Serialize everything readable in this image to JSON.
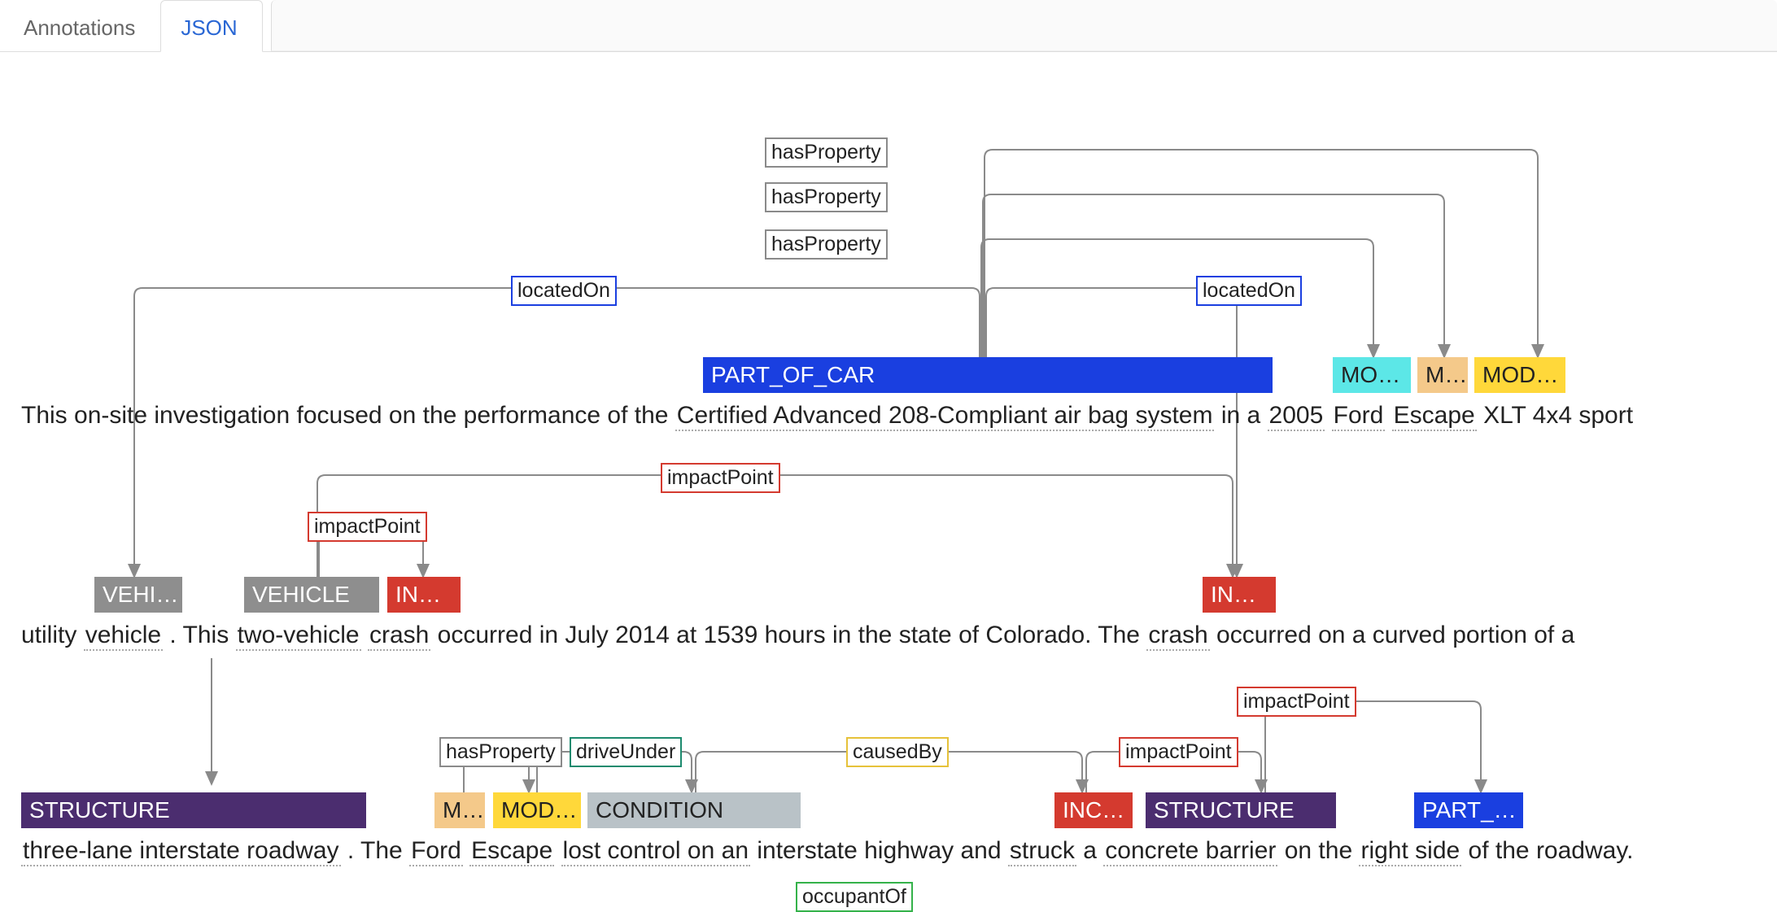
{
  "tabs": {
    "annotations": "Annotations",
    "json": "JSON"
  },
  "line1": {
    "pre": "This on-site investigation focused on the performance of the ",
    "ent_part": "Certified Advanced 208-Compliant air bag system",
    "mid1": " in a ",
    "ent_year": "2005",
    "sp1": " ",
    "ent_make": "Ford",
    "sp2": " ",
    "ent_model": "Escape",
    "tail": " XLT 4x4 sport"
  },
  "line2": {
    "pre": "utility ",
    "ent_vehicle": "vehicle",
    "mid1": " . This ",
    "ent_twoveh": "two-vehicle",
    "sp1": " ",
    "ent_crash1": "crash",
    "mid2": " occurred in July 2014 at 1539 hours in the state of Colorado. The ",
    "ent_crash2": "crash",
    "tail": " occurred on a curved portion of a"
  },
  "line3": {
    "ent_struct1": "three-lane interstate roadway",
    "mid1": " . The ",
    "ent_make2": "Ford",
    "sp1": " ",
    "ent_model2": "Escape",
    "sp2": " ",
    "ent_cond": "lost control on an",
    "mid2": " interstate highway and ",
    "ent_inc": "struck",
    "mid3": " a ",
    "ent_struct2": "concrete barrier",
    "mid4": " on the ",
    "ent_part2": "right side",
    "tail": " of the roadway."
  },
  "labels": {
    "part_of_car": "PART_OF_CAR",
    "mo_trunc": "MO…",
    "m_trunc": "M…",
    "mod_trunc": "MOD…",
    "vehi_trunc": "VEHI…",
    "vehicle": "VEHICLE",
    "in_trunc": "IN…",
    "structure": "STRUCTURE",
    "condition": "CONDITION",
    "inc_trunc": "INC…",
    "part_trunc": "PART_…"
  },
  "relations": {
    "hasProperty": "hasProperty",
    "locatedOn": "locatedOn",
    "impactPoint": "impactPoint",
    "driveUnder": "driveUnder",
    "causedBy": "causedBy",
    "occupantOf": "occupantOf"
  }
}
